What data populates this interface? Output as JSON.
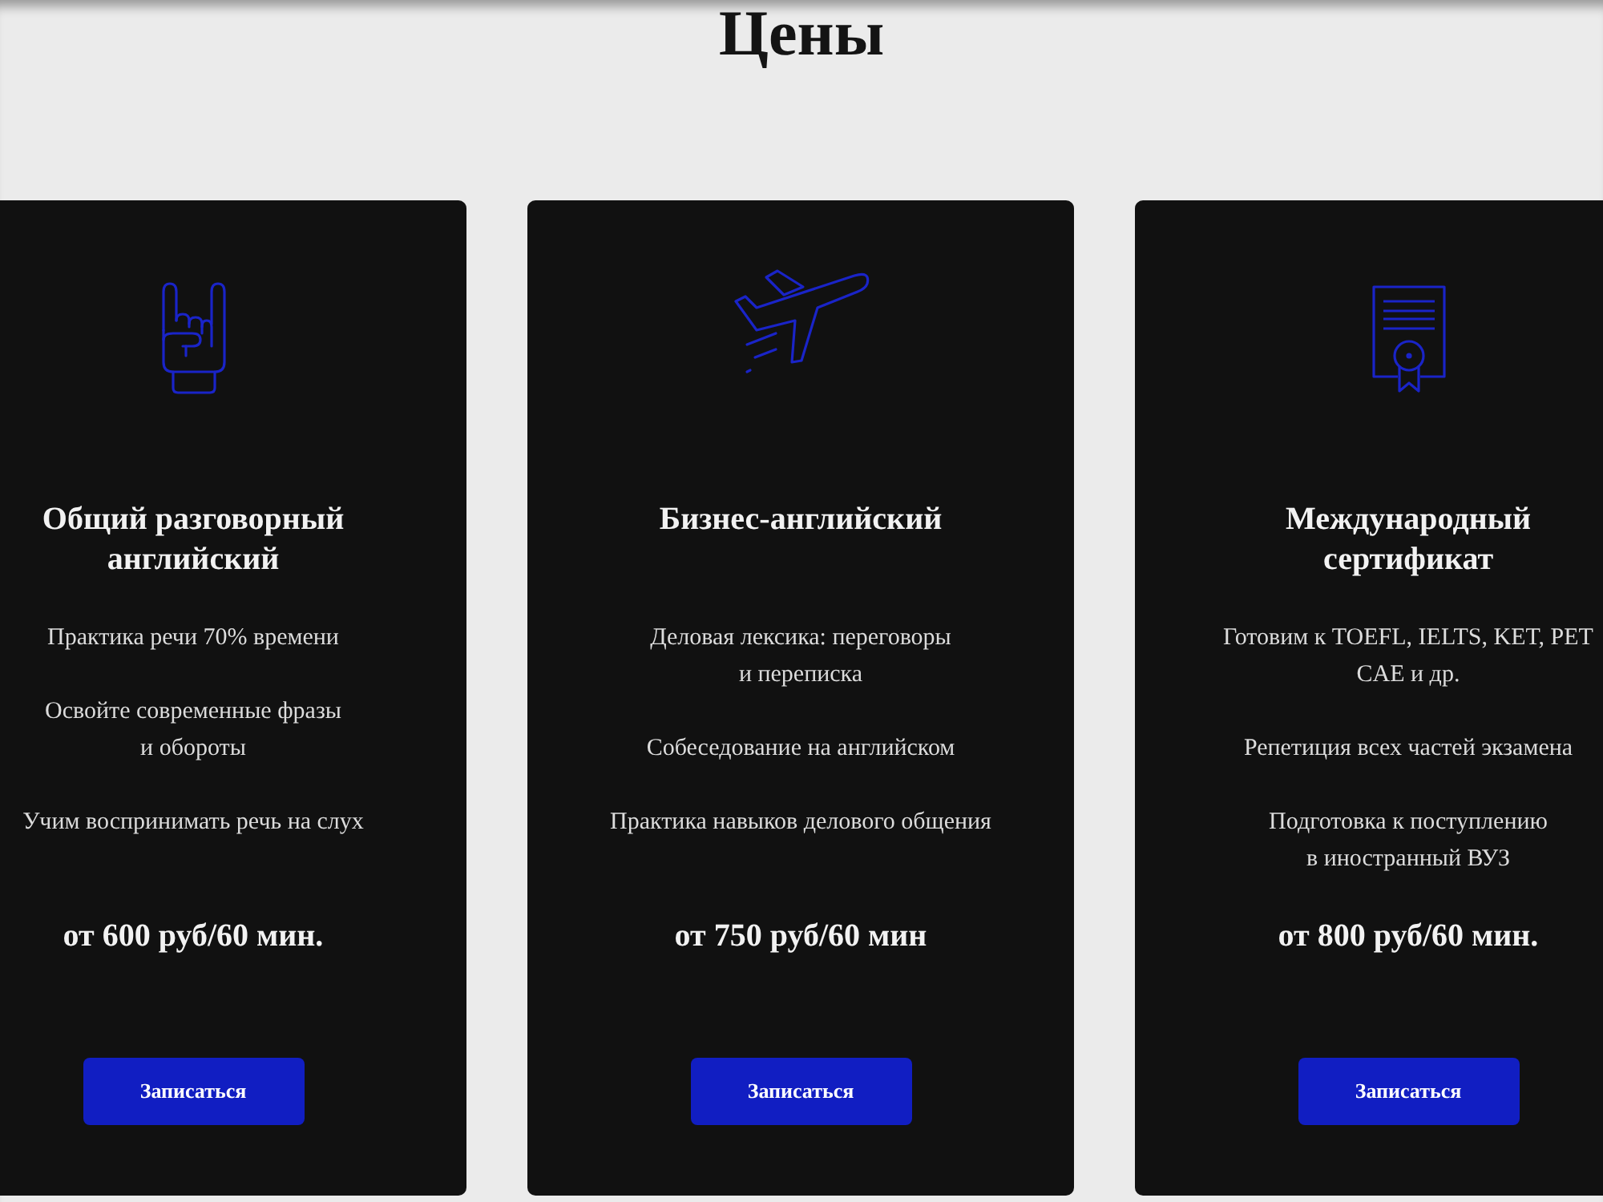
{
  "title": "Цены",
  "cards": [
    {
      "title": "Общий разговорный английский",
      "features": [
        "Практика речи 70% времени",
        "Освойте современные фразы\nи обороты",
        "Учим воспринимать речь на слух"
      ],
      "price": "от 600 руб/60 мин.",
      "button": "Записаться"
    },
    {
      "title": "Бизнес-английский",
      "features": [
        "Деловая лексика: переговоры\nи переписка",
        "Собеседование на английском",
        "Практика навыков делового общения"
      ],
      "price": "от 750 руб/60 мин",
      "button": "Записаться"
    },
    {
      "title": "Международный сертификат",
      "features": [
        "Готовим к TOEFL, IELTS, KET, PET\nCAE и др.",
        "Репетиция всех частей экзамена",
        "Подготовка к поступлению\nв иностранный ВУЗ"
      ],
      "price": "от 800 руб/60 мин.",
      "button": "Записаться"
    }
  ]
}
